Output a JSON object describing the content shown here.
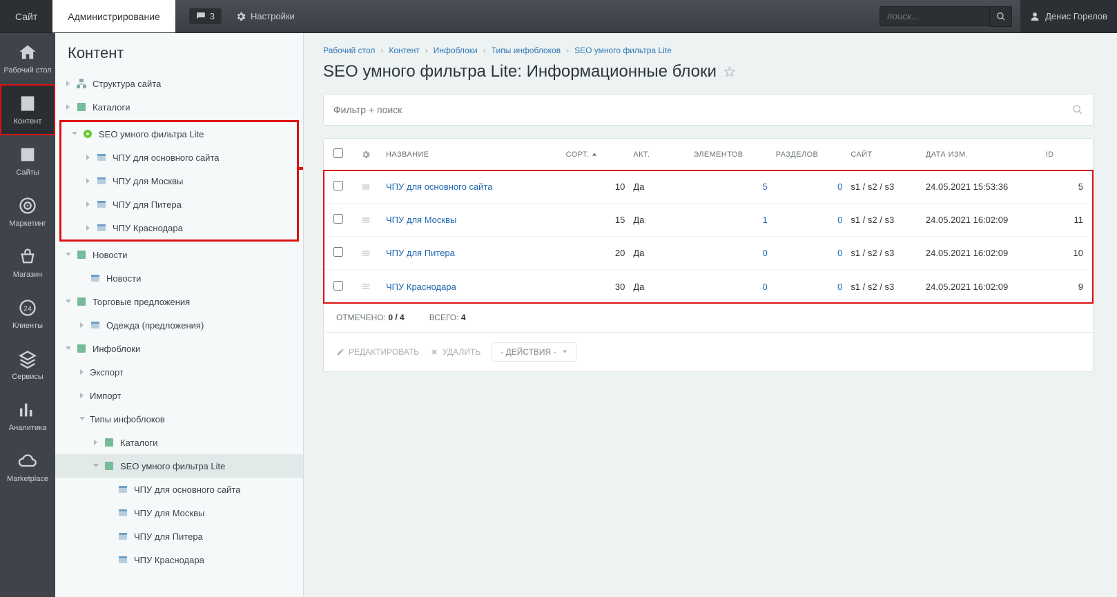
{
  "topbar": {
    "tab_site": "Сайт",
    "tab_admin": "Администрирование",
    "notif_count": "3",
    "settings": "Настройки",
    "search_placeholder": "поиск...",
    "user_name": "Денис Горелов"
  },
  "rail": [
    {
      "key": "desktop",
      "label": "Рабочий стол"
    },
    {
      "key": "content",
      "label": "Контент"
    },
    {
      "key": "sites",
      "label": "Сайты"
    },
    {
      "key": "marketing",
      "label": "Маркетинг"
    },
    {
      "key": "shop",
      "label": "Магазин"
    },
    {
      "key": "clients",
      "label": "Клиенты"
    },
    {
      "key": "services",
      "label": "Сервисы"
    },
    {
      "key": "analytics",
      "label": "Аналитика"
    },
    {
      "key": "marketplace",
      "label": "Marketplace"
    }
  ],
  "sidebar": {
    "title": "Контент",
    "items": {
      "structure": "Структура сайта",
      "catalogs": "Каталоги",
      "seo_root": "SEO умного фильтра Lite",
      "seo_children": [
        "ЧПУ для основного сайта",
        "ЧПУ для Москвы",
        "ЧПУ для Питера",
        "ЧПУ Краснодара"
      ],
      "news_root": "Новости",
      "news_child": "Новости",
      "offers_root": "Торговые предложения",
      "offers_child": "Одежда (предложения)",
      "iblocks_root": "Инфоблоки",
      "iblocks_export": "Экспорт",
      "iblocks_import": "Импорт",
      "iblocks_types": "Типы инфоблоков",
      "types_catalogs": "Каталоги",
      "types_seo": "SEO умного фильтра Lite",
      "types_seo_children": [
        "ЧПУ для основного сайта",
        "ЧПУ для Москвы",
        "ЧПУ для Питера",
        "ЧПУ Краснодара"
      ]
    }
  },
  "crumbs": [
    "Рабочий стол",
    "Контент",
    "Инфоблоки",
    "Типы инфоблоков",
    "SEO умного фильтра Lite"
  ],
  "page_title": "SEO умного фильтра Lite: Информационные блоки",
  "filter_placeholder": "Фильтр + поиск",
  "columns": {
    "name": "НАЗВАНИЕ",
    "sort": "СОРТ.",
    "act": "АКТ.",
    "elements": "ЭЛЕМЕНТОВ",
    "sections": "РАЗДЕЛОВ",
    "site": "САЙТ",
    "date": "ДАТА ИЗМ.",
    "id": "ID"
  },
  "rows": [
    {
      "name": "ЧПУ для основного сайта",
      "sort": "10",
      "act": "Да",
      "elements": "5",
      "sections": "0",
      "site": "s1 / s2 / s3",
      "date": "24.05.2021 15:53:36",
      "id": "5"
    },
    {
      "name": "ЧПУ для Москвы",
      "sort": "15",
      "act": "Да",
      "elements": "1",
      "sections": "0",
      "site": "s1 / s2 / s3",
      "date": "24.05.2021 16:02:09",
      "id": "11"
    },
    {
      "name": "ЧПУ для Питера",
      "sort": "20",
      "act": "Да",
      "elements": "0",
      "sections": "0",
      "site": "s1 / s2 / s3",
      "date": "24.05.2021 16:02:09",
      "id": "10"
    },
    {
      "name": "ЧПУ Краснодара",
      "sort": "30",
      "act": "Да",
      "elements": "0",
      "sections": "0",
      "site": "s1 / s2 / s3",
      "date": "24.05.2021 16:02:09",
      "id": "9"
    }
  ],
  "footer": {
    "selected_label": "ОТМЕЧЕНО:",
    "selected": "0 / 4",
    "total_label": "ВСЕГО:",
    "total": "4"
  },
  "actions": {
    "edit": "РЕДАКТИРОВАТЬ",
    "delete": "УДАЛИТЬ",
    "dd": "- ДЕЙСТВИЯ -"
  }
}
